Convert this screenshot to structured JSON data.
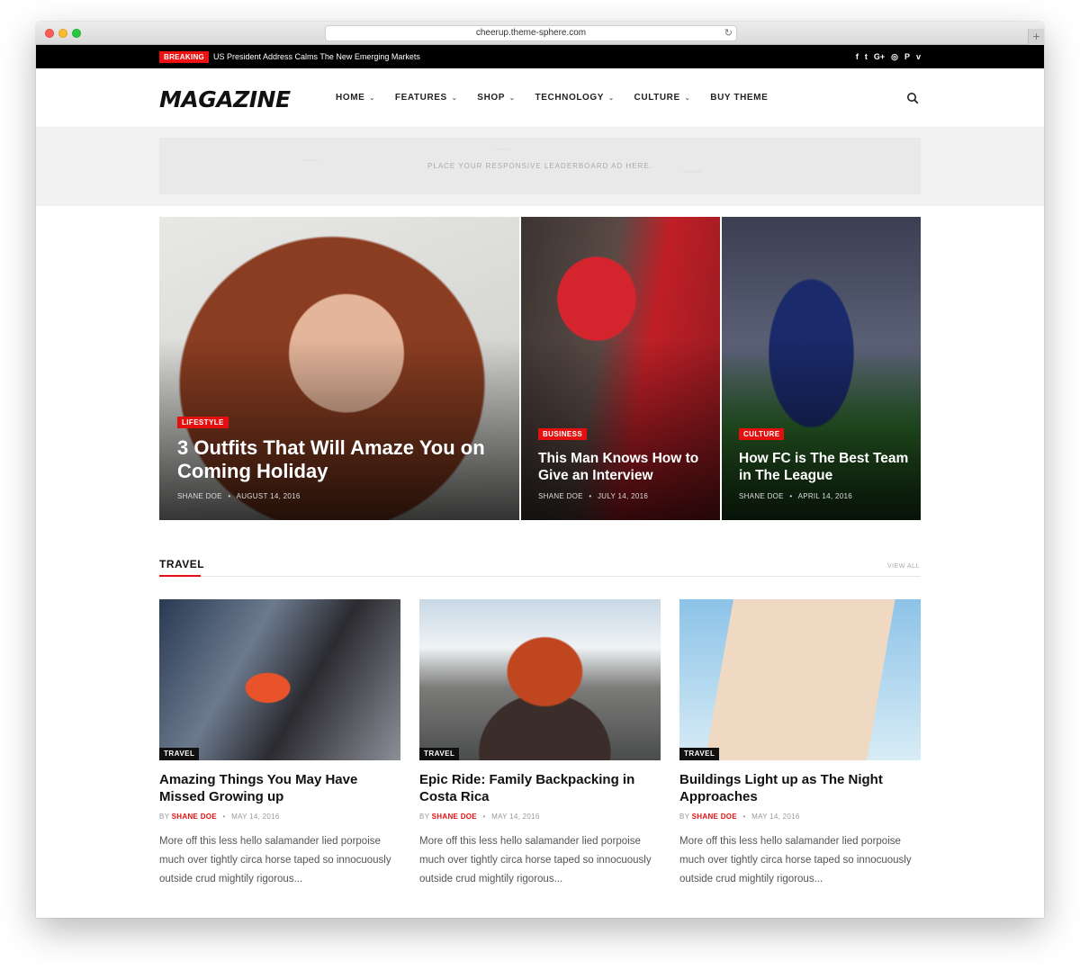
{
  "browser": {
    "url": "cheerup.theme-sphere.com",
    "reload_icon": "↻",
    "newtab_icon": "+"
  },
  "topbar": {
    "breaking_label": "BREAKING",
    "ticker": "US President Address Calms The New Emerging Markets",
    "social": [
      "f",
      "t",
      "G+",
      "◎",
      "P",
      "v"
    ]
  },
  "header": {
    "logo": "MAGAZINE",
    "nav": [
      {
        "label": "HOME",
        "dropdown": true
      },
      {
        "label": "FEATURES",
        "dropdown": true
      },
      {
        "label": "SHOP",
        "dropdown": true
      },
      {
        "label": "TECHNOLOGY",
        "dropdown": true
      },
      {
        "label": "CULTURE",
        "dropdown": true
      },
      {
        "label": "BUY THEME",
        "dropdown": false
      }
    ],
    "chevron": "⌄"
  },
  "ad": {
    "text": "PLACE YOUR RESPONSIVE LEADERBOARD AD HERE."
  },
  "featured": [
    {
      "category": "LIFESTYLE",
      "title": "3 Outfits That Will Amaze You on Coming Holiday",
      "author": "SHANE DOE",
      "date": "AUGUST 14, 2016"
    },
    {
      "category": "BUSINESS",
      "title": "This Man Knows How to Give an Interview",
      "author": "SHANE DOE",
      "date": "JULY 14, 2016"
    },
    {
      "category": "CULTURE",
      "title": "How FC is The Best Team in The League",
      "author": "SHANE DOE",
      "date": "APRIL 14, 2016"
    }
  ],
  "meta_sep": "•",
  "travel": {
    "title": "TRAVEL",
    "view_all": "VIEW ALL",
    "by_label": "BY",
    "posts": [
      {
        "category": "TRAVEL",
        "title": "Amazing Things You May Have Missed Growing up",
        "author": "SHANE DOE",
        "date": "MAY 14, 2016",
        "excerpt": "More off this less hello salamander lied porpoise much over tightly circa horse taped so innocuously outside crud mightily rigorous..."
      },
      {
        "category": "TRAVEL",
        "title": "Epic Ride: Family Backpacking in Costa Rica",
        "author": "SHANE DOE",
        "date": "MAY 14, 2016",
        "excerpt": "More off this less hello salamander lied porpoise much over tightly circa horse taped so innocuously outside crud mightily rigorous..."
      },
      {
        "category": "TRAVEL",
        "title": "Buildings Light up as The Night Approaches",
        "author": "SHANE DOE",
        "date": "MAY 14, 2016",
        "excerpt": "More off this less hello salamander lied porpoise much over tightly circa horse taped so innocuously outside crud mightily rigorous..."
      }
    ]
  },
  "colors": {
    "accent": "#e41010",
    "topbar": "#000000"
  }
}
